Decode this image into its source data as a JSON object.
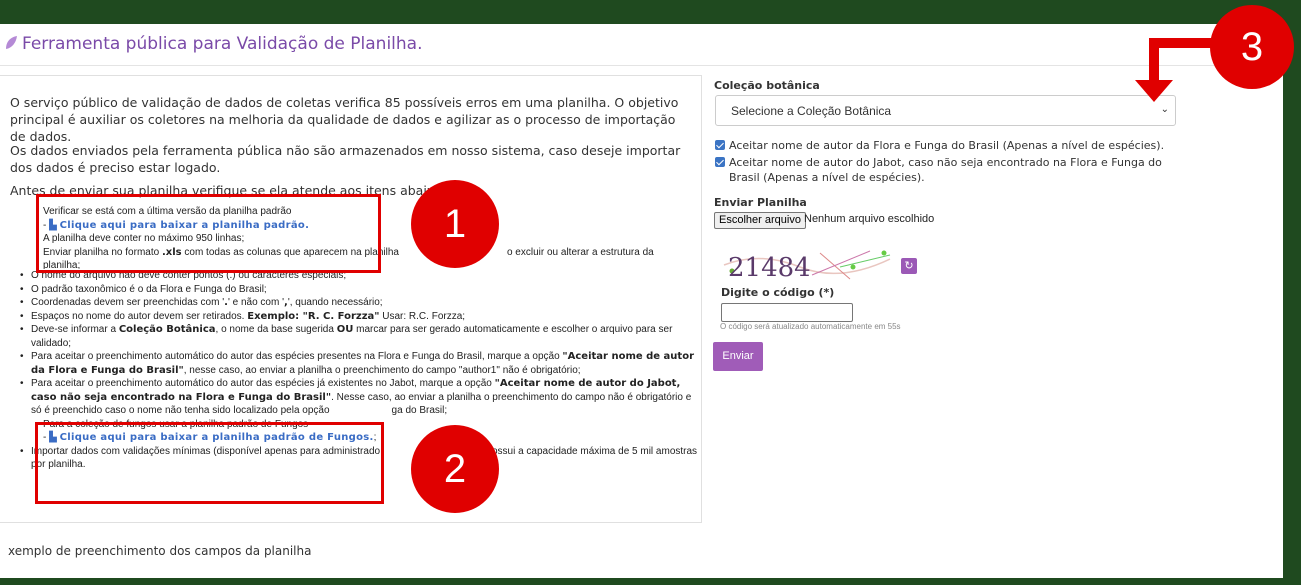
{
  "header": {
    "title": "Ferramenta pública para Validação de Planilha."
  },
  "intro": {
    "p1": "O serviço público de validação de dados de coletas verifica 85 possíveis erros em uma planilha. O objetivo principal é auxiliar os coletores na melhoria da qualidade de dados e agilizar as o processo de importação de dados.",
    "p2": "Os dados enviados pela ferramenta pública não são armazenados em nosso sistema, caso deseje importar dos dados é preciso estar logado.",
    "p3": "Antes de enviar sua planilha verifique se ela atende aos itens abaixo:"
  },
  "checklist": {
    "verify": "Verificar se está com a última versão da planilha padrão",
    "download_link": "Clique aqui para baixar a planilha padrão.",
    "max_lines": "A planilha deve conter no máximo 950 linhas;",
    "format_a": "Enviar planilha no formato ",
    "format_b": ".xls",
    "format_c": " com todas as colunas que aparecem na planilha",
    "format_d": "o excluir ou alterar a estrutura da",
    "format_e": "planilha;",
    "item1": "O nome do arquivo não deve conter pontos (.) ou caracteres especiais;",
    "item2": "O padrão taxonômico é o da Flora e Funga do Brasil;",
    "item3a": "Coordenadas devem ser preenchidas com '",
    "item3b": ".",
    "item3c": "' e não com '",
    "item3d": ",",
    "item3e": "', quando necessário;",
    "item4a": "Espaços no nome do autor devem ser retirados. ",
    "item4b": "Exemplo: \"R. C. Forzza\"",
    "item4c": " Usar: R.C. Forzza",
    "item4d": ";",
    "item5a": "Deve-se informar a ",
    "item5b": "Coleção Botânica",
    "item5c": ", o nome da base sugerida ",
    "item5d": "OU",
    "item5e": " marcar para ser gerado automaticamente e escolher o arquivo para ser validado;",
    "item6a": "Para aceitar o preenchimento automático do autor das espécies presentes na Flora e Funga do Brasil, marque a opção ",
    "item6b": "\"Aceitar nome de autor da Flora e Funga do Brasil\"",
    "item6c": ", nesse caso, ao enviar a planilha o preenchimento do campo \"author1\" não é obrigatório;",
    "item7a": "Para aceitar o preenchimento automático do autor das espécies já existentes no Jabot, marque a opção ",
    "item7b": "\"Aceitar nome de autor do Jabot, caso não seja encontrado na Flora e Funga do Brasil\"",
    "item7c": ". Nesse caso, ao enviar a planilha o preenchimento do campo não é obrigatório e só é preenchido caso o nome não tenha sido localizado pela opção",
    "item7d": "ga do Brasil;",
    "item8": "Para a coleção de fungos usar a planilha padrão de Fungos",
    "fungi_link": "Clique aqui para baixar a planilha padrão de Fungos.",
    "item9a": "Importar dados com validações mínimas (disponível apenas para administrado",
    "item9b": "o possui a capacidade máxima de 5 mil amostras por planilha."
  },
  "form": {
    "collection_label": "Coleção botânica",
    "collection_select": "Selecione a Coleção Botânica",
    "check1": "Aceitar nome de autor da Flora e Funga do Brasil (Apenas a nível de espécies).",
    "check2a": "Aceitar nome de autor do Jabot, caso não seja encontrado na Flora e Funga do",
    "check2b": "Brasil (Apenas a nível de espécies).",
    "upload_label": "Enviar Planilha",
    "file_button": "Escolher arquivo",
    "file_status": "Nenhum arquivo escolhido",
    "captcha_text": "21484",
    "code_label": "Digite o código (*)",
    "code_hint": "O código será atualizado automaticamente em 55s",
    "submit": "Enviar"
  },
  "footer": {
    "example": "xemplo de preenchimento dos campos da planilha"
  },
  "annotations": {
    "n1": "1",
    "n2": "2",
    "n3": "3"
  }
}
